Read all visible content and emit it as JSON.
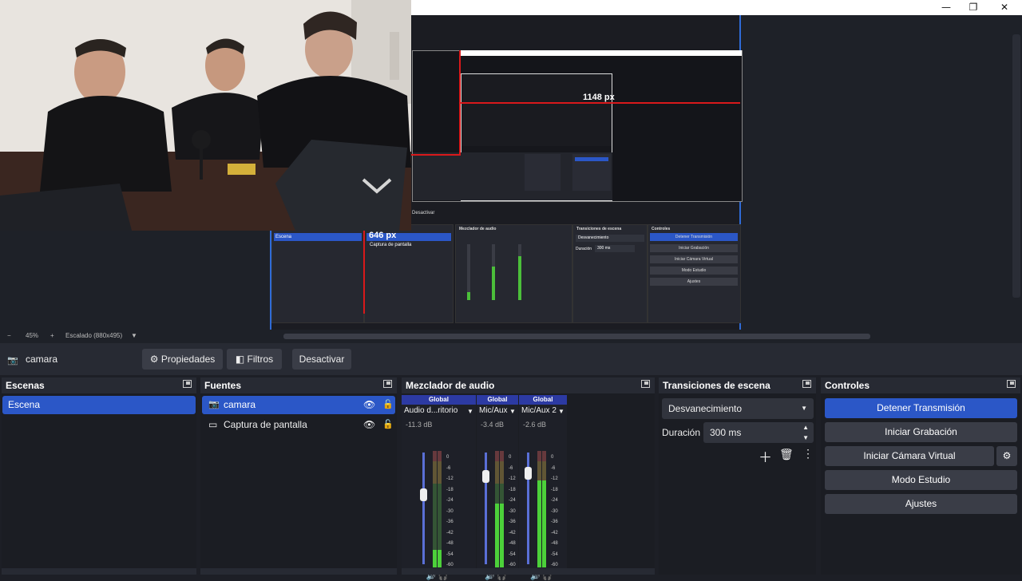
{
  "window": {
    "min_icon": "minimize-icon",
    "max_icon": "restore-icon",
    "close_icon": "close-icon"
  },
  "mini_preview": {
    "measure_w": "1148 px",
    "measure_h": "646 px",
    "desactivar": "Desactivar",
    "mixer_title": "Mezclador de audio",
    "trans_title": "Transiciones de escena",
    "ctrl_title": "Controles",
    "scene": "Escena",
    "source2": "Captura de pantalla",
    "trans_value": "Desvanecimiento",
    "duration_label": "Duración",
    "duration_value": "300 ms",
    "buttons": [
      "Detener Transmisión",
      "Iniciar Grabación",
      "Iniciar Cámara Virtual",
      "Modo Estudio",
      "Ajustes"
    ],
    "mix_names": [
      "Audio d...ritorio",
      "Mic/Aux",
      "Mic/Aux 2"
    ]
  },
  "zoombar": {
    "minus": "−",
    "zoom": "45%",
    "plus": "+",
    "scale": "Escalado (880x495)"
  },
  "context": {
    "source_icon": "camera-icon",
    "source_name": "camara",
    "properties": "Propiedades",
    "filters": "Filtros",
    "deactivate": "Desactivar"
  },
  "scenes": {
    "title": "Escenas",
    "items": [
      "Escena"
    ]
  },
  "sources": {
    "title": "Fuentes",
    "items": [
      "camara",
      "Captura de pantalla"
    ]
  },
  "mixer": {
    "title": "Mezclador de audio",
    "channels": [
      {
        "global": "Global",
        "name": "Audio d...ritorio",
        "db": "-11.3 dB",
        "level": 0.15,
        "fader": 0.68
      },
      {
        "global": "Global",
        "name": "Mic/Aux",
        "db": "-3.4 dB",
        "level": 0.55,
        "fader": 0.84
      },
      {
        "global": "Global",
        "name": "Mic/Aux 2",
        "db": "-2.6 dB",
        "level": 0.75,
        "fader": 0.87
      }
    ],
    "scale": [
      "0",
      "-6",
      "-12",
      "-18",
      "-24",
      "-30",
      "-36",
      "-42",
      "-48",
      "-54",
      "-60"
    ]
  },
  "transitions": {
    "title": "Transiciones de escena",
    "selected": "Desvanecimiento",
    "duration_label": "Duración",
    "duration_value": "300 ms"
  },
  "controls": {
    "title": "Controles",
    "stop_stream": "Detener Transmisión",
    "start_recording": "Iniciar Grabación",
    "start_virtualcam": "Iniciar Cámara Virtual",
    "studio_mode": "Modo Estudio",
    "settings": "Ajustes"
  },
  "colors": {
    "accent": "#2b57c7",
    "panel": "#272a33",
    "bg": "#1b1d23",
    "measure": "#d9191b"
  }
}
